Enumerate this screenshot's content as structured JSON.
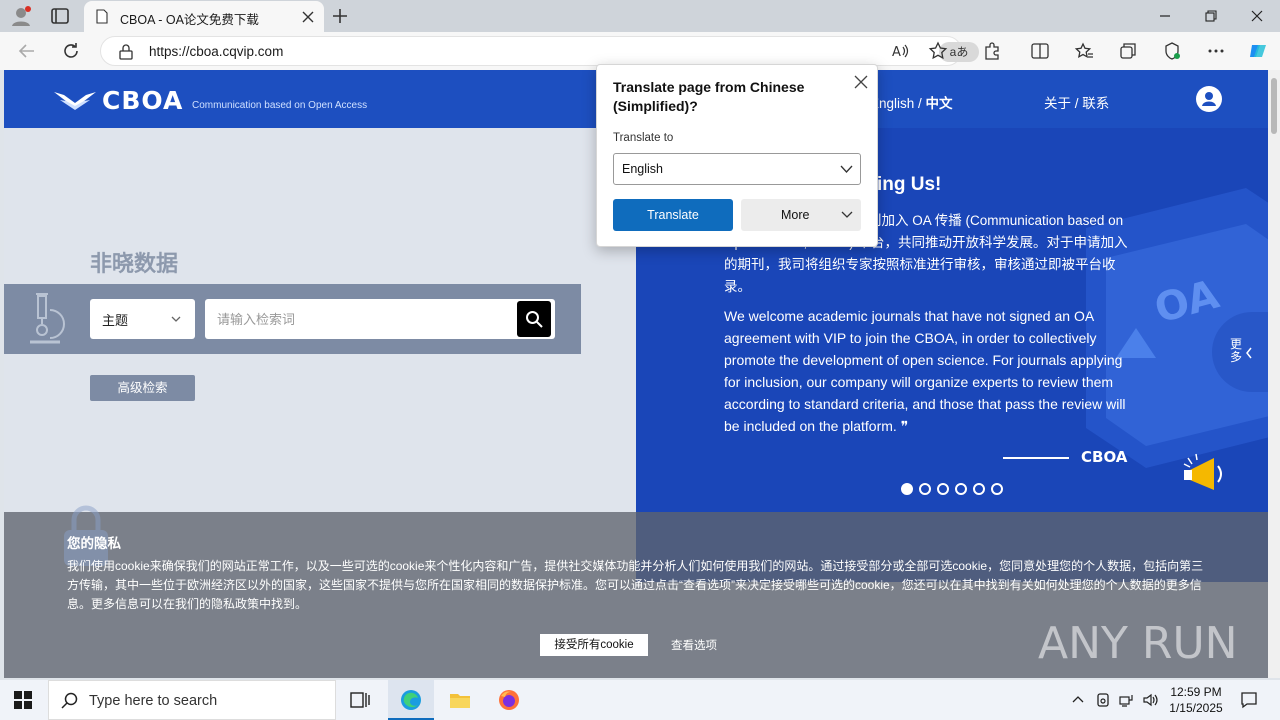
{
  "browser": {
    "tab_title": "CBOA - OA论文免费下载",
    "url": "https://cboa.cqvip.com",
    "read_aloud_label": "aあ"
  },
  "site": {
    "logo_text": "CBOA",
    "logo_tagline": "Communication based on Open Access",
    "lang_english": "English",
    "lang_sep": " / ",
    "lang_chinese": "中文",
    "about_contact": "关于 / 联系",
    "brand_title": "非晓数据",
    "search": {
      "type_label": "主题",
      "placeholder": "请输入检索词"
    },
    "advanced_search": "高级检索"
  },
  "carousel": {
    "heading": "ing Us!",
    "para_cn": "OA 协议的国内外学术期刊加入 OA 传播 (Communication based on Open Access, CBOA) 平台，共同推动开放科学发展。对于申请加入的期刊，我司将组织专家按照标准进行审核，审核通过即被平台收录。",
    "para_en": "We welcome academic journals that have not signed an OA agreement with VIP to join the CBOA, in order to collectively promote the development of open science. For journals applying for inclusion, our company will organize experts to review them according to standard criteria, and those that pass the review will be included on the platform.  ❞",
    "signature": "CBOA",
    "more_label": "更多",
    "slide_count": 6,
    "active_slide": 1
  },
  "translate_popup": {
    "title": "Translate page from Chinese (Simplified)?",
    "translate_to_label": "Translate to",
    "selected_language": "English",
    "translate_button": "Translate",
    "more_button": "More"
  },
  "cookie_banner": {
    "heading": "您的隐私",
    "body": "我们使用cookie来确保我们的网站正常工作，以及一些可选的cookie来个性化内容和广告，提供社交媒体功能并分析人们如何使用我们的网站。通过接受部分或全部可选cookie，您同意处理您的个人数据，包括向第三方传输，其中一些位于欧洲经济区以外的国家，这些国家不提供与您所在国家相同的数据保护标准。您可以通过点击“查看选项”来决定接受哪些可选的cookie，您还可以在其中找到有关如何处理您的个人数据的更多信息。更多信息可以在我们的隐私政策中找到。",
    "accept_button": "接受所有cookie",
    "options_link": "查看选项"
  },
  "watermark": "ANY RUN",
  "taskbar": {
    "search_placeholder": "Type here to search",
    "time": "12:59 PM",
    "date": "1/15/2025"
  },
  "colors": {
    "header_blue": "#1d4fc0",
    "carousel_blue": "#1a46b8",
    "edge_accent": "#0f6cbd",
    "search_band": "#7d8ba4"
  }
}
